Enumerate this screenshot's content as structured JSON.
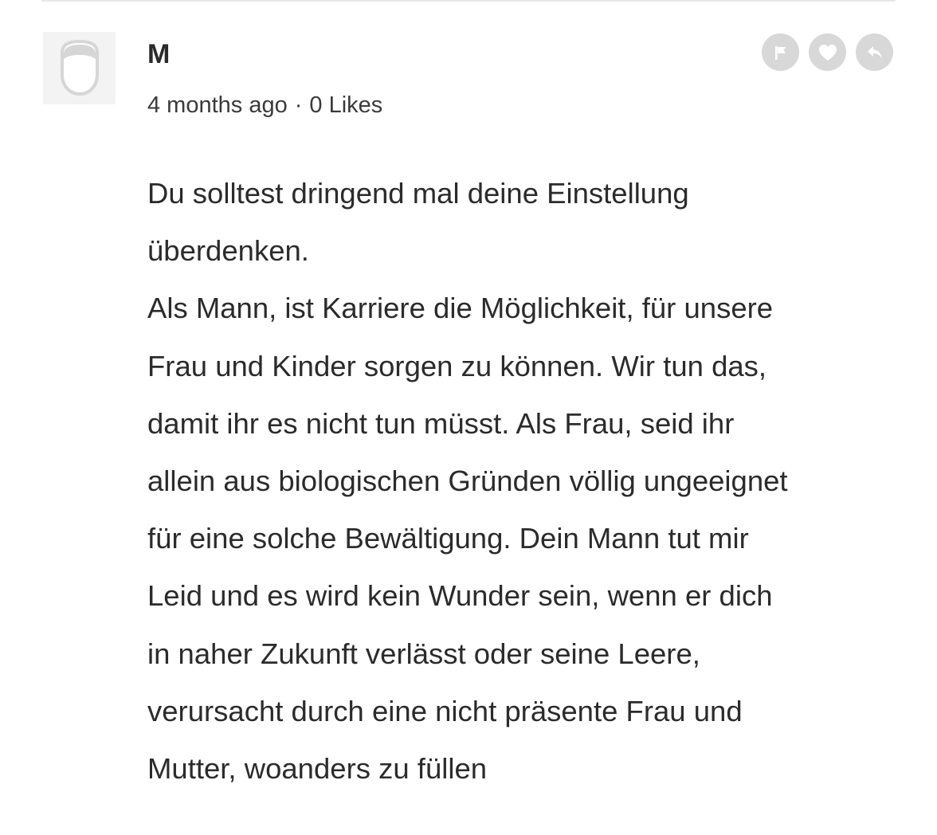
{
  "comment": {
    "author": "M",
    "time_ago": "4 months ago",
    "separator": "·",
    "likes": "0 Likes",
    "avatar_icon": "default-avatar-icon",
    "actions": [
      {
        "name": "report-flag-icon"
      },
      {
        "name": "like-heart-icon"
      },
      {
        "name": "reply-icon"
      }
    ],
    "body_lines": [
      "Du solltest dringend mal deine Einstellung",
      "überdenken.",
      "Als Mann, ist Karriere die Möglichkeit, für unsere",
      "Frau und Kinder sorgen zu können. Wir tun das,",
      "damit ihr es nicht tun müsst. Als Frau, seid ihr",
      "allein aus biologischen Gründen völlig ungeeignet",
      "für eine solche Bewältigung. Dein Mann tut mir",
      "Leid und es wird kein Wunder sein, wenn er dich",
      "in naher Zukunft verlässt oder seine Leere,",
      "verursacht durch eine nicht präsente Frau und",
      "Mutter, woanders zu füllen"
    ]
  },
  "colors": {
    "text": "#2b2b2b",
    "icon_bg": "#d8d8d8",
    "avatar_bg": "#f3f3f3"
  }
}
